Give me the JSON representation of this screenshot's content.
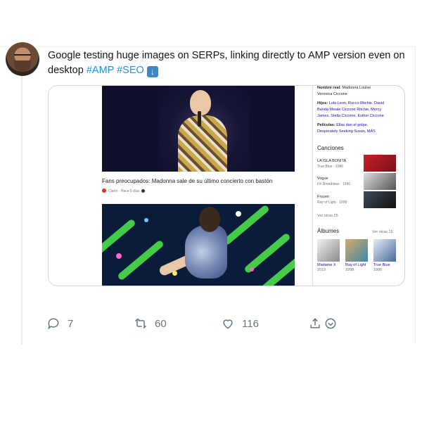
{
  "tweet": {
    "text_before": "Google testing huge images on SERPs, linking directly to AMP version even on desktop ",
    "hashtags": [
      "#AMP",
      "#SEO"
    ],
    "emoji_icon": "down-arrow-emoji-icon"
  },
  "serp": {
    "caption": "Fans preocupados: Madonna sale de su último concierto con bastón",
    "source_name": "Clarín",
    "source_time": "Hace 5 días"
  },
  "knowledge_panel": {
    "real_name_label": "Nombre real:",
    "real_name_value_1": "Madonna Louise",
    "real_name_value_2": "Veronica Ciccone",
    "children_label": "Hijos:",
    "children_line_1": "Lola Leon, Rocco Ritchie, David",
    "children_line_2": "Banda Mwale Ciccone Ritchie, Mercy",
    "children_line_3": "James, Stella Ciccone, Esther Ciccone",
    "movies_label": "Películas:",
    "movies_line_1": "Ellas dan el golpe,",
    "movies_line_2": "Desperately Seeking Susan, MÁS",
    "songs_header": "Canciones",
    "songs": [
      {
        "title": "LA ISLA BONITA",
        "meta": "True Blue · 1986"
      },
      {
        "title": "Vogue",
        "meta": "I'm Breathless · 1990"
      },
      {
        "title": "Frozen",
        "meta": "Ray of Light · 1998"
      }
    ],
    "see_more_songs": "Ver otras 25",
    "albums_header": "Álbumes",
    "see_more_albums": "Ver otras 15",
    "albums": [
      {
        "title": "Madame X",
        "year": "2019"
      },
      {
        "title": "Ray of Light",
        "year": "1998"
      },
      {
        "title": "True Blue",
        "year": "1986"
      }
    ]
  },
  "actions": {
    "replies": "7",
    "retweets": "60",
    "likes": "116"
  }
}
